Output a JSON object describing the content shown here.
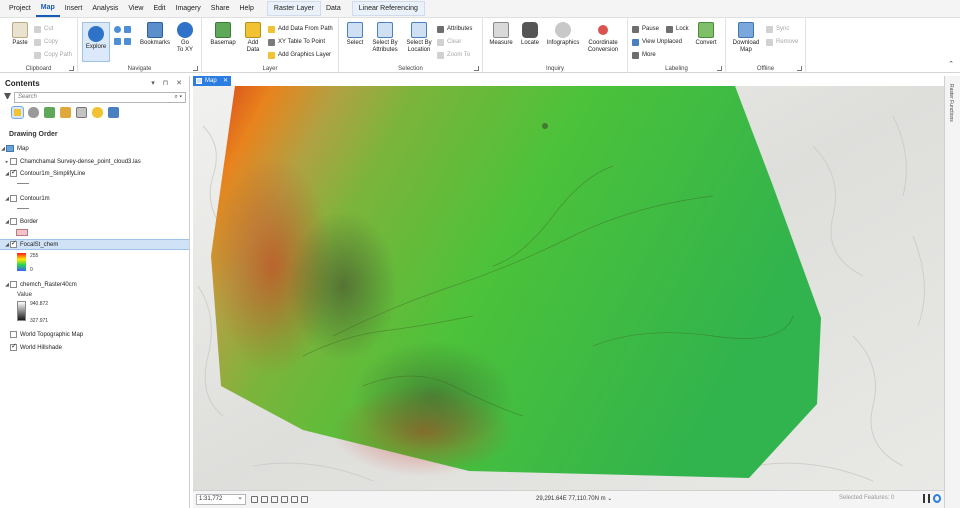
{
  "menu": {
    "tabs": [
      "Project",
      "Map",
      "Insert",
      "Analysis",
      "View",
      "Edit",
      "Imagery",
      "Share",
      "Help"
    ],
    "active_tab": "Map",
    "contextual_tabs": [
      "Raster Layer",
      "Data",
      "Linear Referencing"
    ]
  },
  "ribbon": {
    "clipboard": {
      "label": "Clipboard",
      "paste": "Paste",
      "cut": "Cut",
      "copy": "Copy",
      "copy_path": "Copy Path"
    },
    "navigate": {
      "label": "Navigate",
      "explore": "Explore",
      "bookmarks": "Bookmarks",
      "goto": "Go\nTo XY"
    },
    "layer": {
      "label": "Layer",
      "basemap": "Basemap",
      "add_data": "Add\nData",
      "add_data_from_path": "Add Data From Path",
      "xy_table_to_point": "XY Table To Point",
      "add_graphics_layer": "Add Graphics Layer"
    },
    "selection": {
      "label": "Selection",
      "select": "Select",
      "select_by_attributes": "Select By\nAttributes",
      "select_by_location": "Select By\nLocation",
      "attributes": "Attributes",
      "clear": "Clear",
      "zoom_to": "Zoom To"
    },
    "inquiry": {
      "label": "Inquiry",
      "measure": "Measure",
      "locate": "Locate",
      "infographics": "Infographics",
      "coordinate_conversion": "Coordinate\nConversion"
    },
    "labeling": {
      "label": "Labeling",
      "pause": "Pause",
      "lock": "Lock",
      "view_unplaced": "View Unplaced",
      "more": "More",
      "convert": "Convert"
    },
    "offline": {
      "label": "Offline",
      "download_map": "Download\nMap",
      "sync": "Sync",
      "remove": "Remove"
    }
  },
  "contents": {
    "title": "Contents",
    "search_placeholder": "Search",
    "drawing_order": "Drawing Order",
    "map_name": "Map",
    "layers": [
      {
        "name": "Chamchamal Survey-dense_point_cloud3.las",
        "checked": false
      },
      {
        "name": "Contour1m_SimplifyLine",
        "checked": true
      },
      {
        "name": "Contour1m",
        "checked": false
      },
      {
        "name": "Border",
        "checked": false
      },
      {
        "name": "FocalSt_chem",
        "checked": true,
        "selected": true
      },
      {
        "name": "chemch_Raster40cm",
        "checked": false
      },
      {
        "name": "World Topographic Map",
        "checked": false
      },
      {
        "name": "World Hillshade",
        "checked": true
      }
    ],
    "focal_legend": {
      "high": "255",
      "low": "0"
    },
    "raster_legend": {
      "title": "Value",
      "high": "940.872",
      "low": "327.971"
    }
  },
  "map": {
    "tab_label": "Map",
    "side_panel": "Raster Functions"
  },
  "status": {
    "scale": "1:31,772",
    "coordinates": "29,291.64E 77,110.70N m",
    "selected_features": "Selected Features: 0"
  },
  "colors": {
    "accent": "#1a5bb5",
    "selection_bg": "#cfe2f6",
    "map_tab": "#2b7de1"
  }
}
